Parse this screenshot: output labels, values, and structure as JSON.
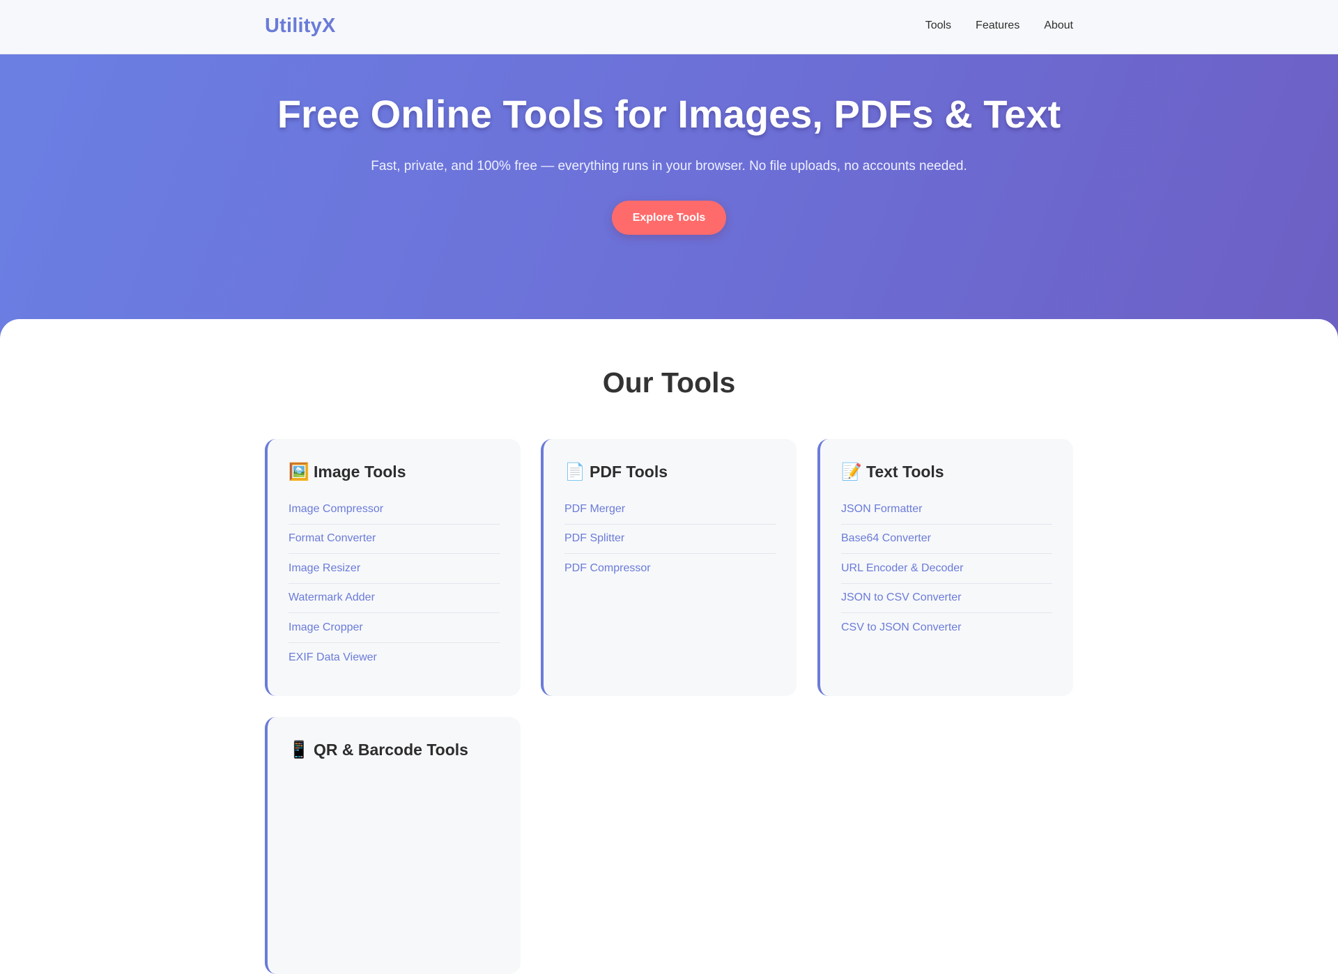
{
  "header": {
    "logo": "UtilityX",
    "nav": [
      "Tools",
      "Features",
      "About"
    ]
  },
  "hero": {
    "title": "Free Online Tools for Images, PDFs & Text",
    "subtitle": "Fast, private, and 100% free — everything runs in your browser. No file uploads, no accounts needed.",
    "cta_label": "Explore Tools"
  },
  "tools_section": {
    "title": "Our Tools",
    "categories": [
      {
        "icon": "🖼️",
        "icon_name": "framed-picture-icon",
        "title": "Image Tools",
        "tools": [
          "Image Compressor",
          "Format Converter",
          "Image Resizer",
          "Watermark Adder",
          "Image Cropper",
          "EXIF Data Viewer"
        ]
      },
      {
        "icon": "📄",
        "icon_name": "document-icon",
        "title": "PDF Tools",
        "tools": [
          "PDF Merger",
          "PDF Splitter",
          "PDF Compressor"
        ]
      },
      {
        "icon": "📝",
        "icon_name": "memo-icon",
        "title": "Text Tools",
        "tools": [
          "JSON Formatter",
          "Base64 Converter",
          "URL Encoder & Decoder",
          "JSON to CSV Converter",
          "CSV to JSON Converter"
        ]
      },
      {
        "icon": "📱",
        "icon_name": "mobile-phone-icon",
        "title": "QR & Barcode Tools",
        "tools": []
      }
    ]
  },
  "colors": {
    "brand": "#6a7bd8",
    "cta": "#ff6b6b",
    "hero_start": "#6b7fe3",
    "hero_end": "#6d5fc4"
  }
}
